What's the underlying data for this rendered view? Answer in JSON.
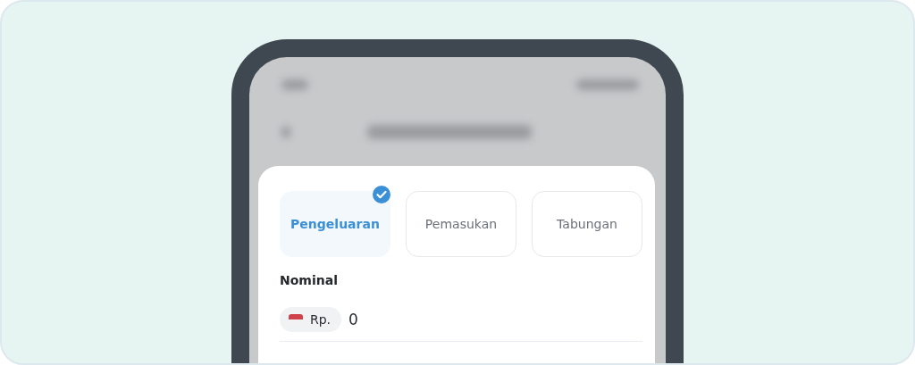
{
  "tabs": [
    {
      "label": "Pengeluaran",
      "selected": true
    },
    {
      "label": "Pemasukan",
      "selected": false
    },
    {
      "label": "Tabungan",
      "selected": false
    }
  ],
  "nominal": {
    "label": "Nominal",
    "currency": "Rp.",
    "value": "0"
  }
}
